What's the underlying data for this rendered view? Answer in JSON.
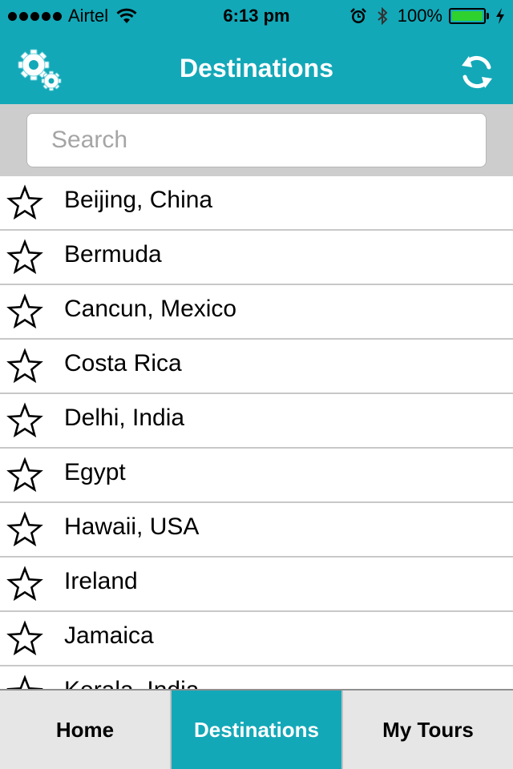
{
  "status_bar": {
    "carrier": "Airtel",
    "time": "6:13 pm",
    "battery": "100%",
    "icons": [
      "signal-dots-icon",
      "wifi-icon",
      "alarm-icon",
      "bluetooth-icon",
      "battery-icon",
      "charging-bolt-icon"
    ]
  },
  "nav": {
    "title": "Destinations",
    "left_icon": "settings-gears-icon",
    "right_icon": "refresh-icon"
  },
  "search": {
    "placeholder": "Search",
    "value": ""
  },
  "destinations": [
    "Beijing, China",
    "Bermuda",
    "Cancun, Mexico",
    "Costa Rica",
    "Delhi, India",
    "Egypt",
    "Hawaii, USA",
    "Ireland",
    "Jamaica",
    "Kerala, India"
  ],
  "tabs": [
    {
      "label": "Home",
      "active": false
    },
    {
      "label": "Destinations",
      "active": true
    },
    {
      "label": "My Tours",
      "active": false
    }
  ],
  "colors": {
    "accent": "#13a8b8",
    "search_bg": "#cdcdcd",
    "divider": "#c8c8c8",
    "tab_bg": "#e6e6e6",
    "battery_fill": "#2fd12f"
  }
}
